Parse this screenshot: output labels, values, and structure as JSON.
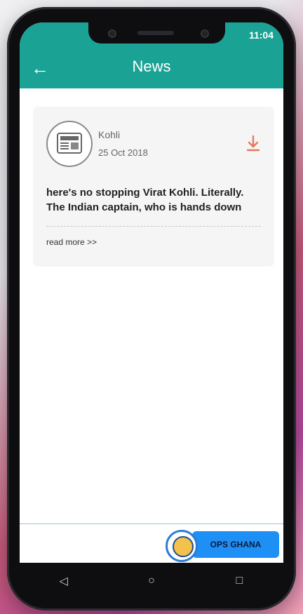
{
  "status": {
    "time": "11:04"
  },
  "appbar": {
    "title": "News",
    "back_icon": "arrow-left-icon"
  },
  "news": [
    {
      "author": "Kohli",
      "date": "25 Oct 2018",
      "snippet_line1": "here's no stopping Virat Kohli. Literally.",
      "snippet_line2": "The Indian captain, who is hands down",
      "read_more": "read more >>",
      "icon": "newspaper-icon",
      "download_icon": "download-icon"
    }
  ],
  "footer": {
    "badge_text": "OPS GHANA"
  },
  "navbar": {
    "back": "◁",
    "home": "○",
    "recents": "□"
  },
  "colors": {
    "accent": "#1aa395",
    "download": "#e4795a",
    "badge": "#1e8ff4"
  }
}
